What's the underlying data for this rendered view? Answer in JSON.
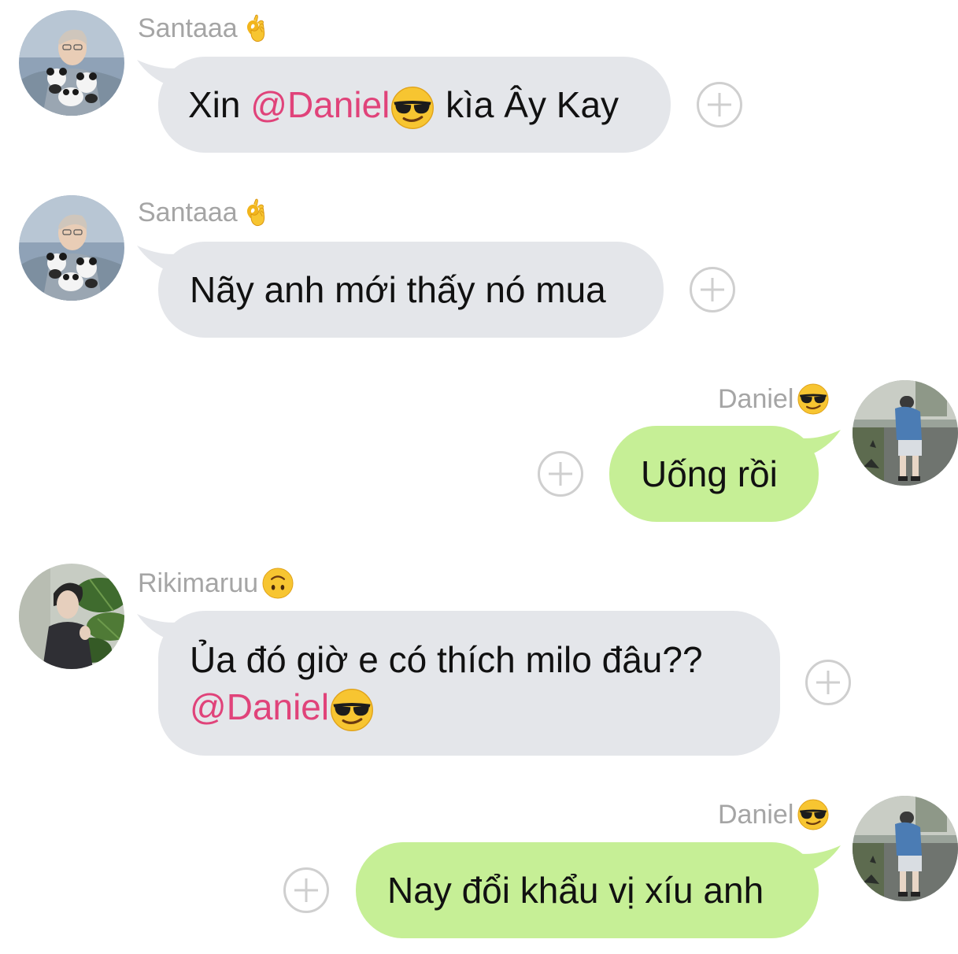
{
  "messages": [
    {
      "sender": "Santaaa",
      "sender_emoji": "ok-hand-emoji",
      "direction": "incoming",
      "text_before": "Xin ",
      "mention": "@Daniel",
      "mention_emoji": "sunglasses-emoji",
      "text_after": " kìa Ây Kay"
    },
    {
      "sender": "Santaaa",
      "sender_emoji": "ok-hand-emoji",
      "direction": "incoming",
      "text": "Nãy anh mới thấy nó mua"
    },
    {
      "sender": "Daniel",
      "sender_emoji": "sunglasses-emoji",
      "direction": "outgoing",
      "text": "Uống rồi"
    },
    {
      "sender": "Rikimaruu",
      "sender_emoji": "upside-down-face-emoji",
      "direction": "incoming",
      "line1": "Ủa đó giờ e có thích milo đâu??",
      "mention": "@Daniel",
      "mention_emoji": "sunglasses-emoji"
    },
    {
      "sender": "Daniel",
      "sender_emoji": "sunglasses-emoji",
      "direction": "outgoing",
      "text": "Nay đổi khẩu vị xíu anh"
    }
  ],
  "colors": {
    "incoming_bubble": "#e4e6ea",
    "outgoing_bubble": "#c6ef96",
    "mention": "#e0437a",
    "sender_name": "#a5a5a5",
    "plus_icon": "#cfcfcf"
  }
}
